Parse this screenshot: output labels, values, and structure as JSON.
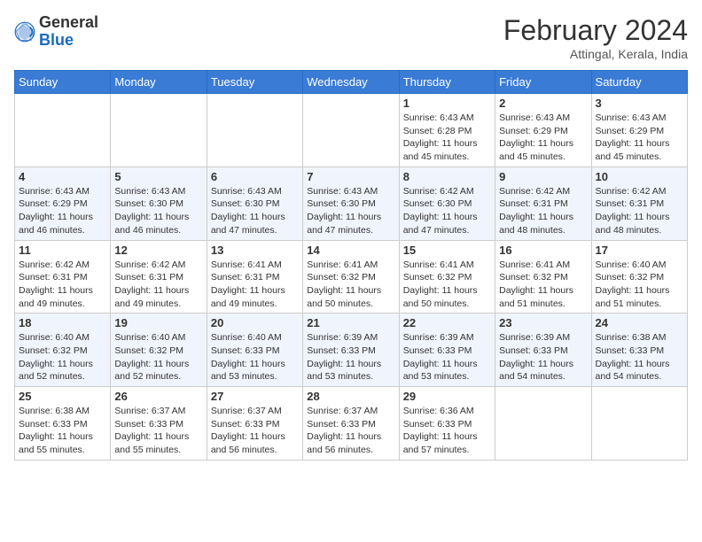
{
  "header": {
    "logo_general": "General",
    "logo_blue": "Blue",
    "month_year": "February 2024",
    "location": "Attingal, Kerala, India"
  },
  "days_of_week": [
    "Sunday",
    "Monday",
    "Tuesday",
    "Wednesday",
    "Thursday",
    "Friday",
    "Saturday"
  ],
  "weeks": [
    [
      {
        "day": "",
        "info": ""
      },
      {
        "day": "",
        "info": ""
      },
      {
        "day": "",
        "info": ""
      },
      {
        "day": "",
        "info": ""
      },
      {
        "day": "1",
        "info": "Sunrise: 6:43 AM\nSunset: 6:28 PM\nDaylight: 11 hours and 45 minutes."
      },
      {
        "day": "2",
        "info": "Sunrise: 6:43 AM\nSunset: 6:29 PM\nDaylight: 11 hours and 45 minutes."
      },
      {
        "day": "3",
        "info": "Sunrise: 6:43 AM\nSunset: 6:29 PM\nDaylight: 11 hours and 45 minutes."
      }
    ],
    [
      {
        "day": "4",
        "info": "Sunrise: 6:43 AM\nSunset: 6:29 PM\nDaylight: 11 hours and 46 minutes."
      },
      {
        "day": "5",
        "info": "Sunrise: 6:43 AM\nSunset: 6:30 PM\nDaylight: 11 hours and 46 minutes."
      },
      {
        "day": "6",
        "info": "Sunrise: 6:43 AM\nSunset: 6:30 PM\nDaylight: 11 hours and 47 minutes."
      },
      {
        "day": "7",
        "info": "Sunrise: 6:43 AM\nSunset: 6:30 PM\nDaylight: 11 hours and 47 minutes."
      },
      {
        "day": "8",
        "info": "Sunrise: 6:42 AM\nSunset: 6:30 PM\nDaylight: 11 hours and 47 minutes."
      },
      {
        "day": "9",
        "info": "Sunrise: 6:42 AM\nSunset: 6:31 PM\nDaylight: 11 hours and 48 minutes."
      },
      {
        "day": "10",
        "info": "Sunrise: 6:42 AM\nSunset: 6:31 PM\nDaylight: 11 hours and 48 minutes."
      }
    ],
    [
      {
        "day": "11",
        "info": "Sunrise: 6:42 AM\nSunset: 6:31 PM\nDaylight: 11 hours and 49 minutes."
      },
      {
        "day": "12",
        "info": "Sunrise: 6:42 AM\nSunset: 6:31 PM\nDaylight: 11 hours and 49 minutes."
      },
      {
        "day": "13",
        "info": "Sunrise: 6:41 AM\nSunset: 6:31 PM\nDaylight: 11 hours and 49 minutes."
      },
      {
        "day": "14",
        "info": "Sunrise: 6:41 AM\nSunset: 6:32 PM\nDaylight: 11 hours and 50 minutes."
      },
      {
        "day": "15",
        "info": "Sunrise: 6:41 AM\nSunset: 6:32 PM\nDaylight: 11 hours and 50 minutes."
      },
      {
        "day": "16",
        "info": "Sunrise: 6:41 AM\nSunset: 6:32 PM\nDaylight: 11 hours and 51 minutes."
      },
      {
        "day": "17",
        "info": "Sunrise: 6:40 AM\nSunset: 6:32 PM\nDaylight: 11 hours and 51 minutes."
      }
    ],
    [
      {
        "day": "18",
        "info": "Sunrise: 6:40 AM\nSunset: 6:32 PM\nDaylight: 11 hours and 52 minutes."
      },
      {
        "day": "19",
        "info": "Sunrise: 6:40 AM\nSunset: 6:32 PM\nDaylight: 11 hours and 52 minutes."
      },
      {
        "day": "20",
        "info": "Sunrise: 6:40 AM\nSunset: 6:33 PM\nDaylight: 11 hours and 53 minutes."
      },
      {
        "day": "21",
        "info": "Sunrise: 6:39 AM\nSunset: 6:33 PM\nDaylight: 11 hours and 53 minutes."
      },
      {
        "day": "22",
        "info": "Sunrise: 6:39 AM\nSunset: 6:33 PM\nDaylight: 11 hours and 53 minutes."
      },
      {
        "day": "23",
        "info": "Sunrise: 6:39 AM\nSunset: 6:33 PM\nDaylight: 11 hours and 54 minutes."
      },
      {
        "day": "24",
        "info": "Sunrise: 6:38 AM\nSunset: 6:33 PM\nDaylight: 11 hours and 54 minutes."
      }
    ],
    [
      {
        "day": "25",
        "info": "Sunrise: 6:38 AM\nSunset: 6:33 PM\nDaylight: 11 hours and 55 minutes."
      },
      {
        "day": "26",
        "info": "Sunrise: 6:37 AM\nSunset: 6:33 PM\nDaylight: 11 hours and 55 minutes."
      },
      {
        "day": "27",
        "info": "Sunrise: 6:37 AM\nSunset: 6:33 PM\nDaylight: 11 hours and 56 minutes."
      },
      {
        "day": "28",
        "info": "Sunrise: 6:37 AM\nSunset: 6:33 PM\nDaylight: 11 hours and 56 minutes."
      },
      {
        "day": "29",
        "info": "Sunrise: 6:36 AM\nSunset: 6:33 PM\nDaylight: 11 hours and 57 minutes."
      },
      {
        "day": "",
        "info": ""
      },
      {
        "day": "",
        "info": ""
      }
    ]
  ]
}
